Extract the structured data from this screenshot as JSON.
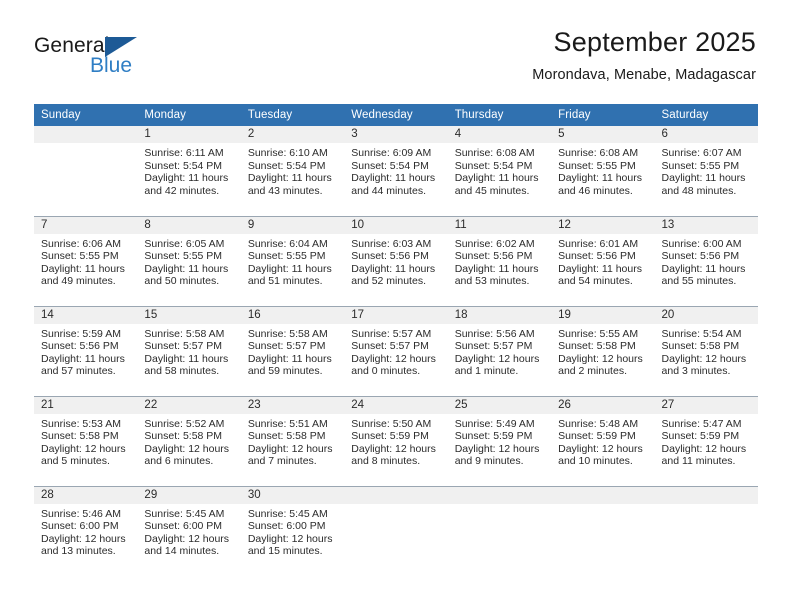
{
  "brand": {
    "name_part1": "General",
    "name_part2": "Blue",
    "flag_icon": "blue-triangle-flag-icon"
  },
  "header": {
    "title": "September 2025",
    "subtitle": "Morondava, Menabe, Madagascar"
  },
  "colors": {
    "header_blue": "#3071B0",
    "logo_blue": "#2f7ec4",
    "logo_flag": "#1d5a96",
    "daynum_band": "#f0f0f0",
    "row_divider": "#9aa6b2",
    "text": "#2b2b2b"
  },
  "weekday_headers": [
    "Sunday",
    "Monday",
    "Tuesday",
    "Wednesday",
    "Thursday",
    "Friday",
    "Saturday"
  ],
  "weeks": [
    [
      {
        "day": "",
        "sunrise": "",
        "sunset": "",
        "daylight1": "",
        "daylight2": "",
        "blank": true
      },
      {
        "day": "1",
        "sunrise": "Sunrise: 6:11 AM",
        "sunset": "Sunset: 5:54 PM",
        "daylight1": "Daylight: 11 hours",
        "daylight2": "and 42 minutes."
      },
      {
        "day": "2",
        "sunrise": "Sunrise: 6:10 AM",
        "sunset": "Sunset: 5:54 PM",
        "daylight1": "Daylight: 11 hours",
        "daylight2": "and 43 minutes."
      },
      {
        "day": "3",
        "sunrise": "Sunrise: 6:09 AM",
        "sunset": "Sunset: 5:54 PM",
        "daylight1": "Daylight: 11 hours",
        "daylight2": "and 44 minutes."
      },
      {
        "day": "4",
        "sunrise": "Sunrise: 6:08 AM",
        "sunset": "Sunset: 5:54 PM",
        "daylight1": "Daylight: 11 hours",
        "daylight2": "and 45 minutes."
      },
      {
        "day": "5",
        "sunrise": "Sunrise: 6:08 AM",
        "sunset": "Sunset: 5:55 PM",
        "daylight1": "Daylight: 11 hours",
        "daylight2": "and 46 minutes."
      },
      {
        "day": "6",
        "sunrise": "Sunrise: 6:07 AM",
        "sunset": "Sunset: 5:55 PM",
        "daylight1": "Daylight: 11 hours",
        "daylight2": "and 48 minutes."
      }
    ],
    [
      {
        "day": "7",
        "sunrise": "Sunrise: 6:06 AM",
        "sunset": "Sunset: 5:55 PM",
        "daylight1": "Daylight: 11 hours",
        "daylight2": "and 49 minutes."
      },
      {
        "day": "8",
        "sunrise": "Sunrise: 6:05 AM",
        "sunset": "Sunset: 5:55 PM",
        "daylight1": "Daylight: 11 hours",
        "daylight2": "and 50 minutes."
      },
      {
        "day": "9",
        "sunrise": "Sunrise: 6:04 AM",
        "sunset": "Sunset: 5:55 PM",
        "daylight1": "Daylight: 11 hours",
        "daylight2": "and 51 minutes."
      },
      {
        "day": "10",
        "sunrise": "Sunrise: 6:03 AM",
        "sunset": "Sunset: 5:56 PM",
        "daylight1": "Daylight: 11 hours",
        "daylight2": "and 52 minutes."
      },
      {
        "day": "11",
        "sunrise": "Sunrise: 6:02 AM",
        "sunset": "Sunset: 5:56 PM",
        "daylight1": "Daylight: 11 hours",
        "daylight2": "and 53 minutes."
      },
      {
        "day": "12",
        "sunrise": "Sunrise: 6:01 AM",
        "sunset": "Sunset: 5:56 PM",
        "daylight1": "Daylight: 11 hours",
        "daylight2": "and 54 minutes."
      },
      {
        "day": "13",
        "sunrise": "Sunrise: 6:00 AM",
        "sunset": "Sunset: 5:56 PM",
        "daylight1": "Daylight: 11 hours",
        "daylight2": "and 55 minutes."
      }
    ],
    [
      {
        "day": "14",
        "sunrise": "Sunrise: 5:59 AM",
        "sunset": "Sunset: 5:56 PM",
        "daylight1": "Daylight: 11 hours",
        "daylight2": "and 57 minutes."
      },
      {
        "day": "15",
        "sunrise": "Sunrise: 5:58 AM",
        "sunset": "Sunset: 5:57 PM",
        "daylight1": "Daylight: 11 hours",
        "daylight2": "and 58 minutes."
      },
      {
        "day": "16",
        "sunrise": "Sunrise: 5:58 AM",
        "sunset": "Sunset: 5:57 PM",
        "daylight1": "Daylight: 11 hours",
        "daylight2": "and 59 minutes."
      },
      {
        "day": "17",
        "sunrise": "Sunrise: 5:57 AM",
        "sunset": "Sunset: 5:57 PM",
        "daylight1": "Daylight: 12 hours",
        "daylight2": "and 0 minutes."
      },
      {
        "day": "18",
        "sunrise": "Sunrise: 5:56 AM",
        "sunset": "Sunset: 5:57 PM",
        "daylight1": "Daylight: 12 hours",
        "daylight2": "and 1 minute."
      },
      {
        "day": "19",
        "sunrise": "Sunrise: 5:55 AM",
        "sunset": "Sunset: 5:58 PM",
        "daylight1": "Daylight: 12 hours",
        "daylight2": "and 2 minutes."
      },
      {
        "day": "20",
        "sunrise": "Sunrise: 5:54 AM",
        "sunset": "Sunset: 5:58 PM",
        "daylight1": "Daylight: 12 hours",
        "daylight2": "and 3 minutes."
      }
    ],
    [
      {
        "day": "21",
        "sunrise": "Sunrise: 5:53 AM",
        "sunset": "Sunset: 5:58 PM",
        "daylight1": "Daylight: 12 hours",
        "daylight2": "and 5 minutes."
      },
      {
        "day": "22",
        "sunrise": "Sunrise: 5:52 AM",
        "sunset": "Sunset: 5:58 PM",
        "daylight1": "Daylight: 12 hours",
        "daylight2": "and 6 minutes."
      },
      {
        "day": "23",
        "sunrise": "Sunrise: 5:51 AM",
        "sunset": "Sunset: 5:58 PM",
        "daylight1": "Daylight: 12 hours",
        "daylight2": "and 7 minutes."
      },
      {
        "day": "24",
        "sunrise": "Sunrise: 5:50 AM",
        "sunset": "Sunset: 5:59 PM",
        "daylight1": "Daylight: 12 hours",
        "daylight2": "and 8 minutes."
      },
      {
        "day": "25",
        "sunrise": "Sunrise: 5:49 AM",
        "sunset": "Sunset: 5:59 PM",
        "daylight1": "Daylight: 12 hours",
        "daylight2": "and 9 minutes."
      },
      {
        "day": "26",
        "sunrise": "Sunrise: 5:48 AM",
        "sunset": "Sunset: 5:59 PM",
        "daylight1": "Daylight: 12 hours",
        "daylight2": "and 10 minutes."
      },
      {
        "day": "27",
        "sunrise": "Sunrise: 5:47 AM",
        "sunset": "Sunset: 5:59 PM",
        "daylight1": "Daylight: 12 hours",
        "daylight2": "and 11 minutes."
      }
    ],
    [
      {
        "day": "28",
        "sunrise": "Sunrise: 5:46 AM",
        "sunset": "Sunset: 6:00 PM",
        "daylight1": "Daylight: 12 hours",
        "daylight2": "and 13 minutes."
      },
      {
        "day": "29",
        "sunrise": "Sunrise: 5:45 AM",
        "sunset": "Sunset: 6:00 PM",
        "daylight1": "Daylight: 12 hours",
        "daylight2": "and 14 minutes."
      },
      {
        "day": "30",
        "sunrise": "Sunrise: 5:45 AM",
        "sunset": "Sunset: 6:00 PM",
        "daylight1": "Daylight: 12 hours",
        "daylight2": "and 15 minutes."
      },
      {
        "day": "",
        "sunrise": "",
        "sunset": "",
        "daylight1": "",
        "daylight2": "",
        "blank": true
      },
      {
        "day": "",
        "sunrise": "",
        "sunset": "",
        "daylight1": "",
        "daylight2": "",
        "blank": true
      },
      {
        "day": "",
        "sunrise": "",
        "sunset": "",
        "daylight1": "",
        "daylight2": "",
        "blank": true
      },
      {
        "day": "",
        "sunrise": "",
        "sunset": "",
        "daylight1": "",
        "daylight2": "",
        "blank": true
      }
    ]
  ]
}
